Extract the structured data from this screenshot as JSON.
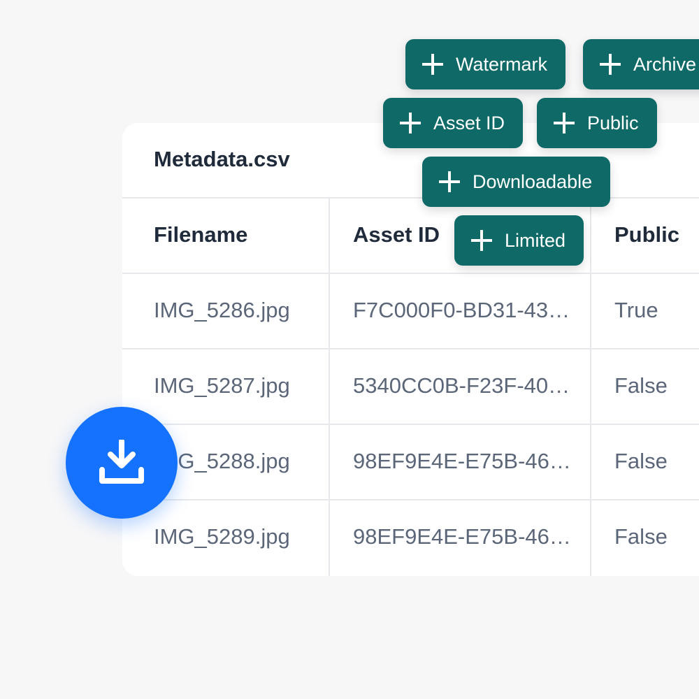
{
  "card": {
    "title": "Metadata.csv"
  },
  "table": {
    "headers": [
      "Filename",
      "Asset ID",
      "Public"
    ],
    "rows": [
      [
        "IMG_5286.jpg",
        "F7C000F0-BD31-43…",
        "True"
      ],
      [
        "IMG_5287.jpg",
        "5340CC0B-F23F-40…",
        "False"
      ],
      [
        "IMG_5288.jpg",
        "98EF9E4E-E75B-46…",
        "False"
      ],
      [
        "IMG_5289.jpg",
        "98EF9E4E-E75B-46…",
        "False"
      ]
    ]
  },
  "chips": [
    {
      "label": "Watermark"
    },
    {
      "label": "Archive"
    },
    {
      "label": "Asset ID"
    },
    {
      "label": "Public"
    },
    {
      "label": "Downloadable"
    },
    {
      "label": "Limited"
    }
  ],
  "fab": {
    "icon": "download-icon"
  },
  "colors": {
    "chip_bg": "#0f6966",
    "fab_bg": "#1472ff",
    "page_bg": "#f7f7f8"
  }
}
